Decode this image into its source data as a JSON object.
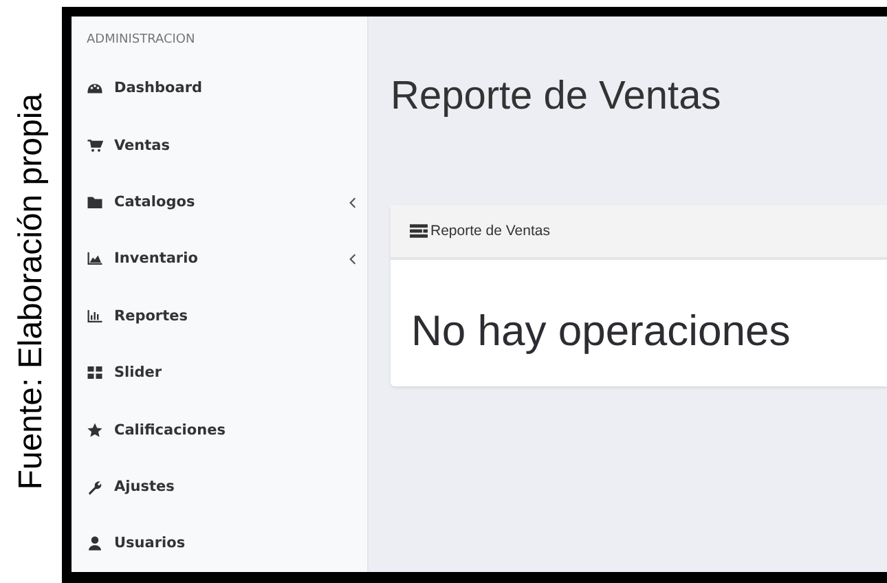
{
  "caption": "Fuente: Elaboración propia",
  "sidebar": {
    "header": "ADMINISTRACION",
    "items": [
      {
        "label": "Dashboard",
        "has_submenu": false
      },
      {
        "label": "Ventas",
        "has_submenu": false
      },
      {
        "label": "Catalogos",
        "has_submenu": true
      },
      {
        "label": "Inventario",
        "has_submenu": true
      },
      {
        "label": "Reportes",
        "has_submenu": false
      },
      {
        "label": "Slider",
        "has_submenu": false
      },
      {
        "label": "Calificaciones",
        "has_submenu": false
      },
      {
        "label": "Ajustes",
        "has_submenu": false
      },
      {
        "label": "Usuarios",
        "has_submenu": false
      }
    ]
  },
  "page_title": "Reporte de Ventas",
  "card": {
    "title": "Reporte de Ventas",
    "message": "No hay operaciones"
  }
}
